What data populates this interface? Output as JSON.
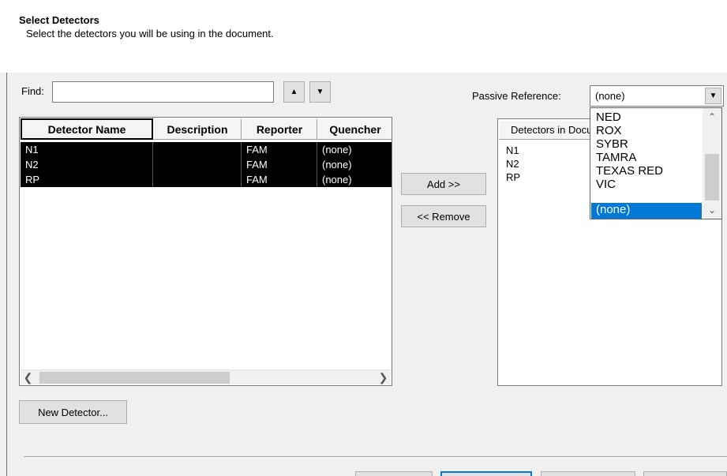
{
  "header": {
    "title": "Select Detectors",
    "subtitle": "Select the detectors you will be using in the document."
  },
  "find": {
    "label": "Find:",
    "value": "",
    "placeholder": "",
    "up_icon": "triangle-up-icon",
    "down_icon": "triangle-down-icon"
  },
  "detector_table": {
    "columns": [
      "Detector Name",
      "Description",
      "Reporter",
      "Quencher"
    ],
    "rows": [
      {
        "name": "N1",
        "description": "",
        "reporter": "FAM",
        "quencher": "(none)"
      },
      {
        "name": "N2",
        "description": "",
        "reporter": "FAM",
        "quencher": "(none)"
      },
      {
        "name": "RP",
        "description": "",
        "reporter": "FAM",
        "quencher": "(none)"
      }
    ],
    "scroll_left_icon": "chevron-left-icon",
    "scroll_right_icon": "chevron-right-icon"
  },
  "actions": {
    "add_label": "Add >>",
    "remove_label": "<< Remove",
    "new_detector_label": "New Detector..."
  },
  "passive_reference": {
    "label": "Passive Reference:",
    "value": "(none)",
    "arrow_icon": "triangle-down-icon",
    "options": [
      "NED",
      "ROX",
      "SYBR",
      "TAMRA",
      "TEXAS RED",
      "VIC",
      "(none)"
    ],
    "selected_index": 6
  },
  "detectors_in_document": {
    "header": "Detectors in Document",
    "items": [
      "N1",
      "N2",
      "RP"
    ]
  },
  "colors": {
    "selection_row": "#000000",
    "dropdown_highlight": "#0078d7",
    "window_bg": "#f0f0f0",
    "header_bg": "#ffffff"
  }
}
